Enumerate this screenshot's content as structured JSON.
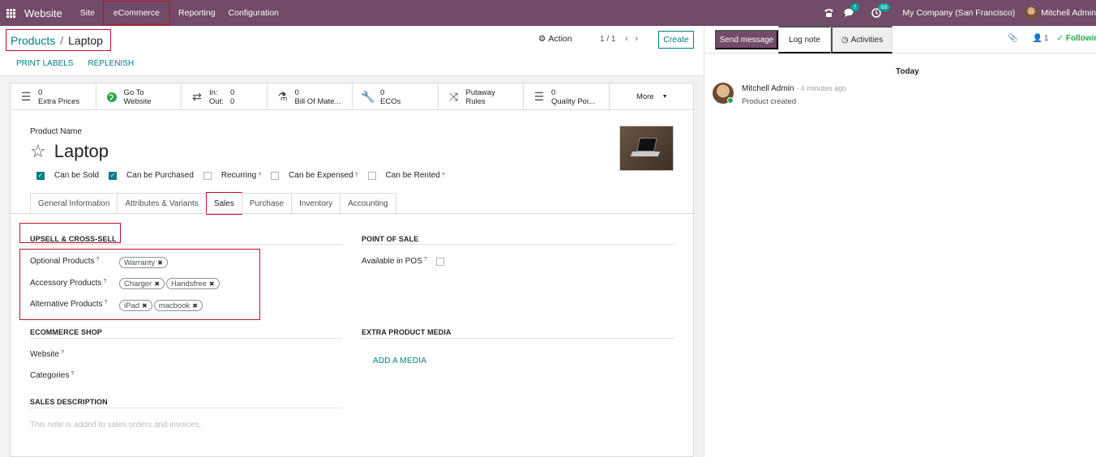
{
  "navbar": {
    "brand": "Website",
    "menus": [
      "Site",
      "eCommerce",
      "Reporting",
      "Configuration"
    ],
    "messages_count": "7",
    "activities_count": "68",
    "company": "My Company (San Francisco)",
    "user": "Mitchell Admin"
  },
  "control_panel": {
    "breadcrumb_parent": "Products",
    "breadcrumb_current": "Laptop",
    "action_label": "Action",
    "pager": "1 / 1",
    "create_label": "Create",
    "print_labels": "PRINT LABELS",
    "replenish": "REPLENISH"
  },
  "smart_buttons": [
    {
      "value": "0",
      "label": "Extra Prices"
    },
    {
      "value": "Go To",
      "label": "Website"
    },
    {
      "in_label": "In:",
      "in_value": "0",
      "out_label": "Out:",
      "out_value": "0"
    },
    {
      "value": "0",
      "label": "Bill Of Mate..."
    },
    {
      "value": "0",
      "label": "ECOs"
    },
    {
      "value": "Putaway",
      "label": "Rules"
    },
    {
      "value": "0",
      "label": "Quality Poi..."
    },
    {
      "label": "More"
    }
  ],
  "product": {
    "name_label": "Product Name",
    "name": "Laptop",
    "checkboxes": [
      {
        "label": "Can be Sold",
        "checked": true,
        "help": false
      },
      {
        "label": "Can be Purchased",
        "checked": true,
        "help": false
      },
      {
        "label": "Recurring",
        "checked": false,
        "help": true
      },
      {
        "label": "Can be Expensed",
        "checked": false,
        "help": true
      },
      {
        "label": "Can be Rented",
        "checked": false,
        "help": true
      }
    ],
    "help_mark": "?"
  },
  "tabs": [
    "General Information",
    "Attributes & Variants",
    "Sales",
    "Purchase",
    "Inventory",
    "Accounting"
  ],
  "active_tab": "Sales",
  "sales_tab": {
    "upsell_title": "UPSELL & CROSS-SELL",
    "optional_label": "Optional Products",
    "optional_tags": [
      "Warranty"
    ],
    "accessory_label": "Accessory Products",
    "accessory_tags": [
      "Charger",
      "Handsfree"
    ],
    "alternative_label": "Alternative Products",
    "alternative_tags": [
      "iPad",
      "macbook"
    ],
    "pos_title": "POINT OF SALE",
    "pos_label": "Available in POS",
    "ecommerce_title": "ECOMMERCE SHOP",
    "website_label": "Website",
    "categories_label": "Categories",
    "media_title": "EXTRA PRODUCT MEDIA",
    "add_media": "ADD A MEDIA",
    "sales_desc_title": "SALES DESCRIPTION",
    "sales_desc_placeholder": "This note is added to sales orders and invoices."
  },
  "chatter": {
    "send_message": "Send message",
    "log_note": "Log note",
    "activities": "Activities",
    "followers_count": "1",
    "following": "Following",
    "today": "Today",
    "author": "Mitchell Admin",
    "time": "- 4 minutes ago",
    "body": "Product created"
  },
  "colors": {
    "brand": "#714B67",
    "accent": "#017E84",
    "highlight": "#c0102a"
  }
}
